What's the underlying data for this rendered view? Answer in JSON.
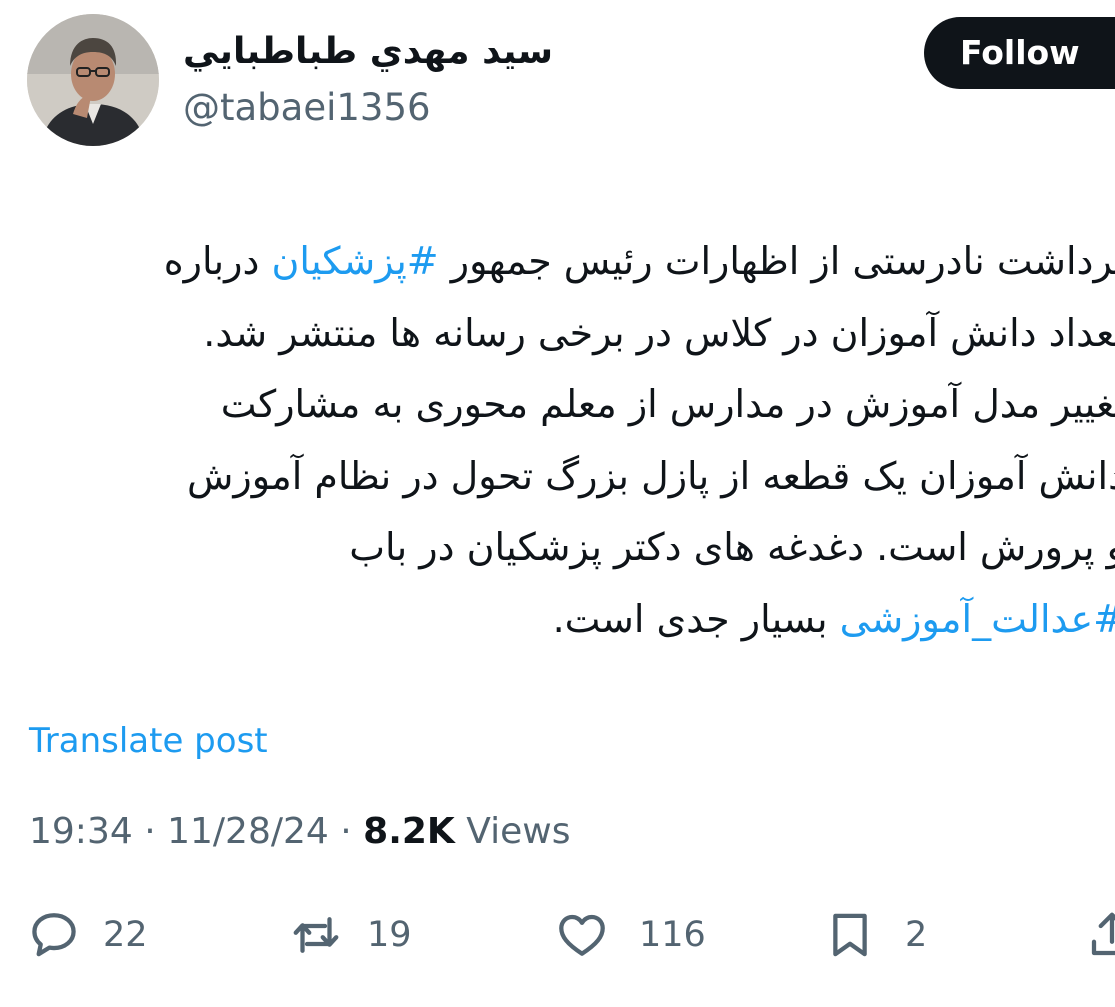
{
  "author": {
    "display_name": "سيد مهدي طباطبايي",
    "handle": "@tabaei1356"
  },
  "follow_button": {
    "label": "Follow"
  },
  "post": {
    "lines": [
      [
        {
          "text": "برداشت نادرستی از اظهارات رئیس جمهور ",
          "hashtag": false
        },
        {
          "text": "#پزشکیان",
          "hashtag": true
        },
        {
          "text": " درباره",
          "hashtag": false
        }
      ],
      [
        {
          "text": "تعداد دانش آموزان در کلاس در برخی رسانه ها منتشر شد.",
          "hashtag": false
        }
      ],
      [
        {
          "text": "تغییر مدل آموزش در مدارس از معلم محوری به مشارکت",
          "hashtag": false
        }
      ],
      [
        {
          "text": "دانش آموزان یک قطعه از پازل بزرگ تحول در نظام آموزش",
          "hashtag": false
        }
      ],
      [
        {
          "text": "و پرورش است. دغدغه های دکتر پزشکیان در باب",
          "hashtag": false
        }
      ],
      [
        {
          "text": "#عدالت_آموزشی",
          "hashtag": true
        },
        {
          "text": " بسیار جدی است.",
          "hashtag": false
        }
      ]
    ],
    "translate_label": "Translate post",
    "time": "19:34",
    "date": "11/28/24",
    "separator": "·",
    "views_count": "8.2K",
    "views_label": "Views"
  },
  "actions": {
    "replies": {
      "icon": "reply-icon",
      "count": "22"
    },
    "reposts": {
      "icon": "repost-icon",
      "count": "19"
    },
    "likes": {
      "icon": "heart-icon",
      "count": "116"
    },
    "bookmarks": {
      "icon": "bookmark-icon",
      "count": "2"
    },
    "share": {
      "icon": "share-icon"
    }
  },
  "colors": {
    "text": "#0f1419",
    "secondary": "#536471",
    "link": "#1d9bf0",
    "button_bg": "#0f1419"
  }
}
